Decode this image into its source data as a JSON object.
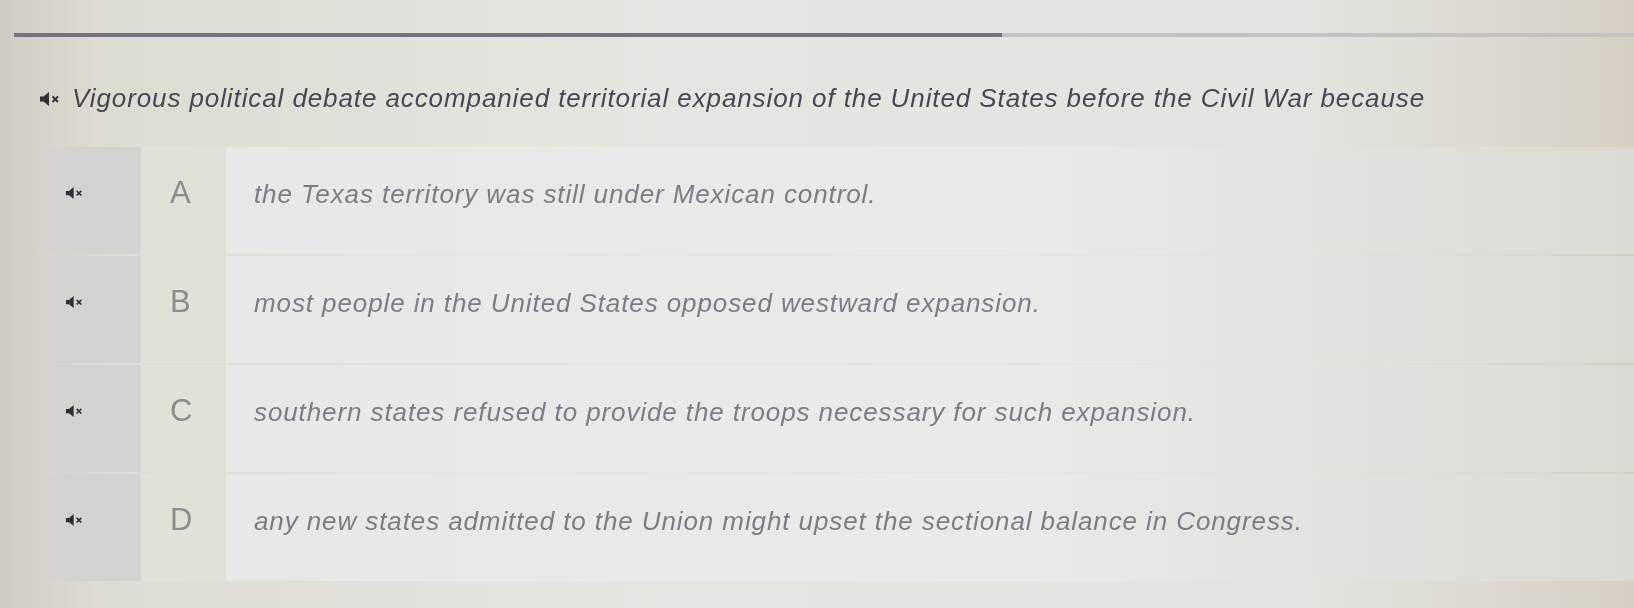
{
  "progress": {
    "level": 0.61
  },
  "question": {
    "text": "Vigorous political debate accompanied territorial expansion of the United States before the Civil War because"
  },
  "options": [
    {
      "letter": "A",
      "text": "the Texas territory was still under Mexican control.",
      "selected": false
    },
    {
      "letter": "B",
      "text": "most people in the United States opposed westward expansion.",
      "selected": false
    },
    {
      "letter": "C",
      "text": "southern states refused to provide the troops necessary for such expansion.",
      "selected": false
    },
    {
      "letter": "D",
      "text": "any new states admitted to the Union might upset the sectional balance in Congress.",
      "selected": false
    }
  ]
}
